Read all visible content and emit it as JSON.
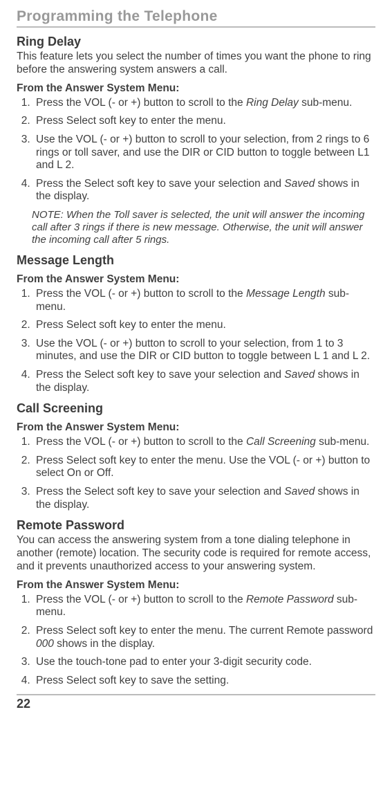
{
  "chapter_title": "Programming the Telephone",
  "page_number": "22",
  "ring_delay": {
    "heading": "Ring Delay",
    "intro": "This feature lets you select the number of times you want the phone to ring before the answering system answers a call.",
    "menu_heading": "From the Answer System Menu:",
    "steps": {
      "s1_a": "Press the VOL (- or +) button to scroll to the ",
      "s1_em": "Ring Delay",
      "s1_b": " sub-menu.",
      "s2": "Press Select soft key to enter the menu.",
      "s3": "Use the VOL (- or +) button to scroll to your selection, from 2 rings to 6 rings or toll saver, and use the DIR or CID button to toggle between L1 and L 2.",
      "s4_a": "Press the Select soft key to save your selection and ",
      "s4_em": "Saved",
      "s4_b": " shows in the display."
    },
    "note": "NOTE: When the Toll saver is selected, the unit will answer the incoming call after 3 rings if there is new message. Otherwise, the unit will answer the incoming call after 5 rings."
  },
  "message_length": {
    "heading": "Message Length",
    "menu_heading": "From the Answer System Menu:",
    "steps": {
      "s1_a": "Press the VOL (- or +) button to scroll to the ",
      "s1_em": "Message Length",
      "s1_b": " sub-menu.",
      "s2": "Press Select soft key to enter the menu.",
      "s3": "Use the VOL (- or +) button to scroll to your selection, from 1 to 3 minutes, and use the DIR or CID button to toggle between L 1 and L 2.",
      "s4_a": "Press the Select soft key to save your selection and ",
      "s4_em": "Saved",
      "s4_b": " shows in the display."
    }
  },
  "call_screening": {
    "heading": "Call Screening",
    "menu_heading": "From the Answer System Menu:",
    "steps": {
      "s1_a": "Press the VOL (- or +) button to scroll to the ",
      "s1_em": "Call Screening",
      "s1_b": " sub-menu.",
      "s2": "Press Select soft key to enter the menu. Use the VOL (- or +) button to select On or Off.",
      "s3_a": "Press the Select soft key to save your selection and ",
      "s3_em": "Saved",
      "s3_b": " shows in the display."
    }
  },
  "remote_password": {
    "heading": "Remote Password",
    "intro": "You can access the answering system from a tone dialing telephone in another (remote) location. The security code is required for remote access, and it prevents unauthorized access to your answering system.",
    "menu_heading": "From the Answer System Menu:",
    "steps": {
      "s1_a": "Press the VOL (- or +) button to scroll to the ",
      "s1_em": "Remote Password",
      "s1_b": " sub-menu.",
      "s2_a": "Press Select soft key to enter the menu. The current Remote password ",
      "s2_em": "000",
      "s2_b": " shows in the display.",
      "s3": "Use the touch-tone pad to enter your 3-digit security code.",
      "s4": "Press Select soft key to save the setting."
    }
  }
}
